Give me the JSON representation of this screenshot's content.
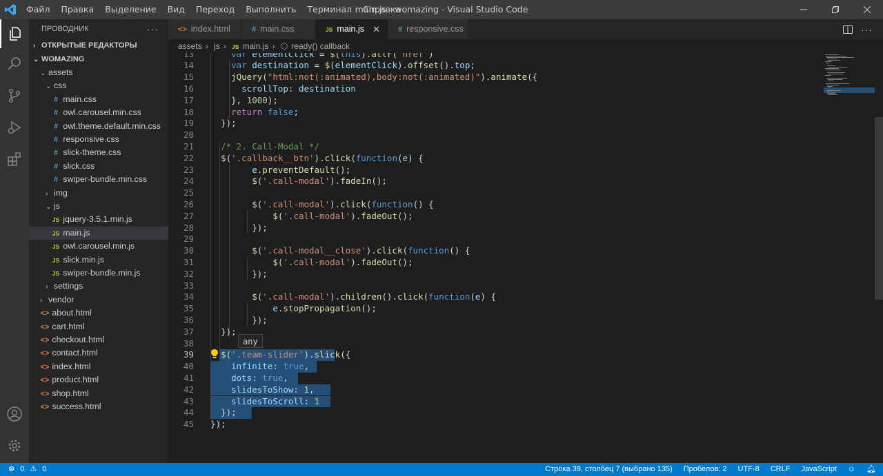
{
  "titlebar": {
    "menu": [
      "Файл",
      "Правка",
      "Выделение",
      "Вид",
      "Переход",
      "Выполнить",
      "Терминал",
      "Справка"
    ],
    "title": "main.js - womazing - Visual Studio Code"
  },
  "sidebar": {
    "header": "ПРОВОДНИК",
    "open_editors": "ОТКРЫТЫЕ РЕДАКТОРЫ",
    "project": "WOMAZING",
    "tree": [
      {
        "label": "assets",
        "type": "folder-open",
        "depth": 1
      },
      {
        "label": "css",
        "type": "folder-open",
        "depth": 2
      },
      {
        "label": "main.css",
        "type": "css",
        "depth": 3
      },
      {
        "label": "owl.carousel.min.css",
        "type": "css",
        "depth": 3
      },
      {
        "label": "owl.theme.default.min.css",
        "type": "css",
        "depth": 3
      },
      {
        "label": "responsive.css",
        "type": "css",
        "depth": 3
      },
      {
        "label": "slick-theme.css",
        "type": "css",
        "depth": 3
      },
      {
        "label": "slick.css",
        "type": "css",
        "depth": 3
      },
      {
        "label": "swiper-bundle.min.css",
        "type": "css",
        "depth": 3
      },
      {
        "label": "img",
        "type": "folder",
        "depth": 2
      },
      {
        "label": "js",
        "type": "folder-open",
        "depth": 2
      },
      {
        "label": "jquery-3.5.1.min.js",
        "type": "js",
        "depth": 3
      },
      {
        "label": "main.js",
        "type": "js",
        "depth": 3,
        "selected": true
      },
      {
        "label": "owl.carousel.min.js",
        "type": "js",
        "depth": 3
      },
      {
        "label": "slick.min.js",
        "type": "js",
        "depth": 3
      },
      {
        "label": "swiper-bundle.min.js",
        "type": "js",
        "depth": 3
      },
      {
        "label": "settings",
        "type": "folder",
        "depth": 2
      },
      {
        "label": "vendor",
        "type": "folder",
        "depth": 1
      },
      {
        "label": "about.html",
        "type": "html",
        "depth": 1
      },
      {
        "label": "cart.html",
        "type": "html",
        "depth": 1
      },
      {
        "label": "checkout.html",
        "type": "html",
        "depth": 1
      },
      {
        "label": "contact.html",
        "type": "html",
        "depth": 1
      },
      {
        "label": "index.html",
        "type": "html",
        "depth": 1
      },
      {
        "label": "product.html",
        "type": "html",
        "depth": 1
      },
      {
        "label": "shop.html",
        "type": "html",
        "depth": 1
      },
      {
        "label": "success.html",
        "type": "html",
        "depth": 1
      }
    ]
  },
  "tabs": [
    {
      "label": "index.html",
      "icon": "<>",
      "active": false
    },
    {
      "label": "main.css",
      "icon": "#",
      "active": false
    },
    {
      "label": "main.js",
      "icon": "JS",
      "active": true
    },
    {
      "label": "responsive.css",
      "icon": "#",
      "active": false
    }
  ],
  "breadcrumbs": [
    "assets",
    "js",
    "main.js",
    "ready() callback"
  ],
  "code_lines": [
    {
      "n": 13,
      "html": "    <span class='k'>var</span> <span class='v'>elementClick</span> = <span class='f'>$</span>(<span class='k'>this</span>).<span class='f'>attr</span>(<span class='s'>'href'</span>)"
    },
    {
      "n": 14,
      "html": "    <span class='k'>var</span> <span class='v'>destination</span> = <span class='f'>$</span>(<span class='v'>elementClick</span>).<span class='f'>offset</span>().<span class='v'>top</span>;"
    },
    {
      "n": 15,
      "html": "    <span class='f'>jQuery</span>(<span class='s'>\"html:not(:animated),body:not(:animated)\"</span>).<span class='f'>animate</span>({"
    },
    {
      "n": 16,
      "html": "      <span class='v'>scrollTop</span>: <span class='v'>destination</span>"
    },
    {
      "n": 17,
      "html": "    }, <span class='n'>1000</span>);"
    },
    {
      "n": 18,
      "html": "    <span class='kw'>return</span> <span class='k'>false</span>;"
    },
    {
      "n": 19,
      "html": "  });"
    },
    {
      "n": 20,
      "html": ""
    },
    {
      "n": 21,
      "html": "  <span class='c'>/* 2. Call-Modal */</span>"
    },
    {
      "n": 22,
      "html": "  <span class='f'>$</span>(<span class='s'>'.callback__btn'</span>).<span class='f'>click</span>(<span class='k'>function</span>(<span class='v'>e</span>) {"
    },
    {
      "n": 23,
      "html": "        <span class='v'>e</span>.<span class='f'>preventDefault</span>();"
    },
    {
      "n": 24,
      "html": "        <span class='f'>$</span>(<span class='s'>'.call-modal'</span>).<span class='f'>fadeIn</span>();"
    },
    {
      "n": 25,
      "html": ""
    },
    {
      "n": 26,
      "html": "        <span class='f'>$</span>(<span class='s'>'.call-modal'</span>).<span class='f'>click</span>(<span class='k'>function</span>() {"
    },
    {
      "n": 27,
      "html": "            <span class='f'>$</span>(<span class='s'>'.call-modal'</span>).<span class='f'>fadeOut</span>();"
    },
    {
      "n": 28,
      "html": "        });"
    },
    {
      "n": 29,
      "html": ""
    },
    {
      "n": 30,
      "html": "        <span class='f'>$</span>(<span class='s'>'.call-modal__close'</span>).<span class='f'>click</span>(<span class='k'>function</span>() {"
    },
    {
      "n": 31,
      "html": "            <span class='f'>$</span>(<span class='s'>'.call-modal'</span>).<span class='f'>fadeOut</span>();"
    },
    {
      "n": 32,
      "html": "        });"
    },
    {
      "n": 33,
      "html": ""
    },
    {
      "n": 34,
      "html": "        <span class='f'>$</span>(<span class='s'>'.call-modal'</span>).<span class='f'>children</span>().<span class='f'>click</span>(<span class='k'>function</span>(<span class='v'>e</span>) {"
    },
    {
      "n": 35,
      "html": "            <span class='v'>e</span>.<span class='f'>stopPropagation</span>();"
    },
    {
      "n": 36,
      "html": "        });"
    },
    {
      "n": 37,
      "html": "  });"
    },
    {
      "n": 38,
      "html": ""
    },
    {
      "n": 39,
      "html": "  <span class='f'>$</span>(<span class='s'>'.team-slider'</span>).<span class='f'>slick</span>({"
    },
    {
      "n": 40,
      "html": "    <span class='v'>infinite</span>: <span class='k'>true</span>,"
    },
    {
      "n": 41,
      "html": "    <span class='v'>dots</span>: <span class='k'>true</span>,"
    },
    {
      "n": 42,
      "html": "    <span class='v'>slidesToShow</span>: <span class='n'>1</span>,"
    },
    {
      "n": 43,
      "html": "    <span class='v'>slidesToScroll</span>: <span class='n'>1</span>"
    },
    {
      "n": 44,
      "html": "  });"
    },
    {
      "n": 45,
      "html": "});"
    }
  ],
  "tooltip": "any",
  "status": {
    "errors": "0",
    "warnings": "0",
    "cursor": "Строка 39, столбец 7 (выбрано 135)",
    "spaces": "Пробелов: 2",
    "encoding": "UTF-8",
    "eol": "CRLF",
    "language": "JavaScript"
  }
}
